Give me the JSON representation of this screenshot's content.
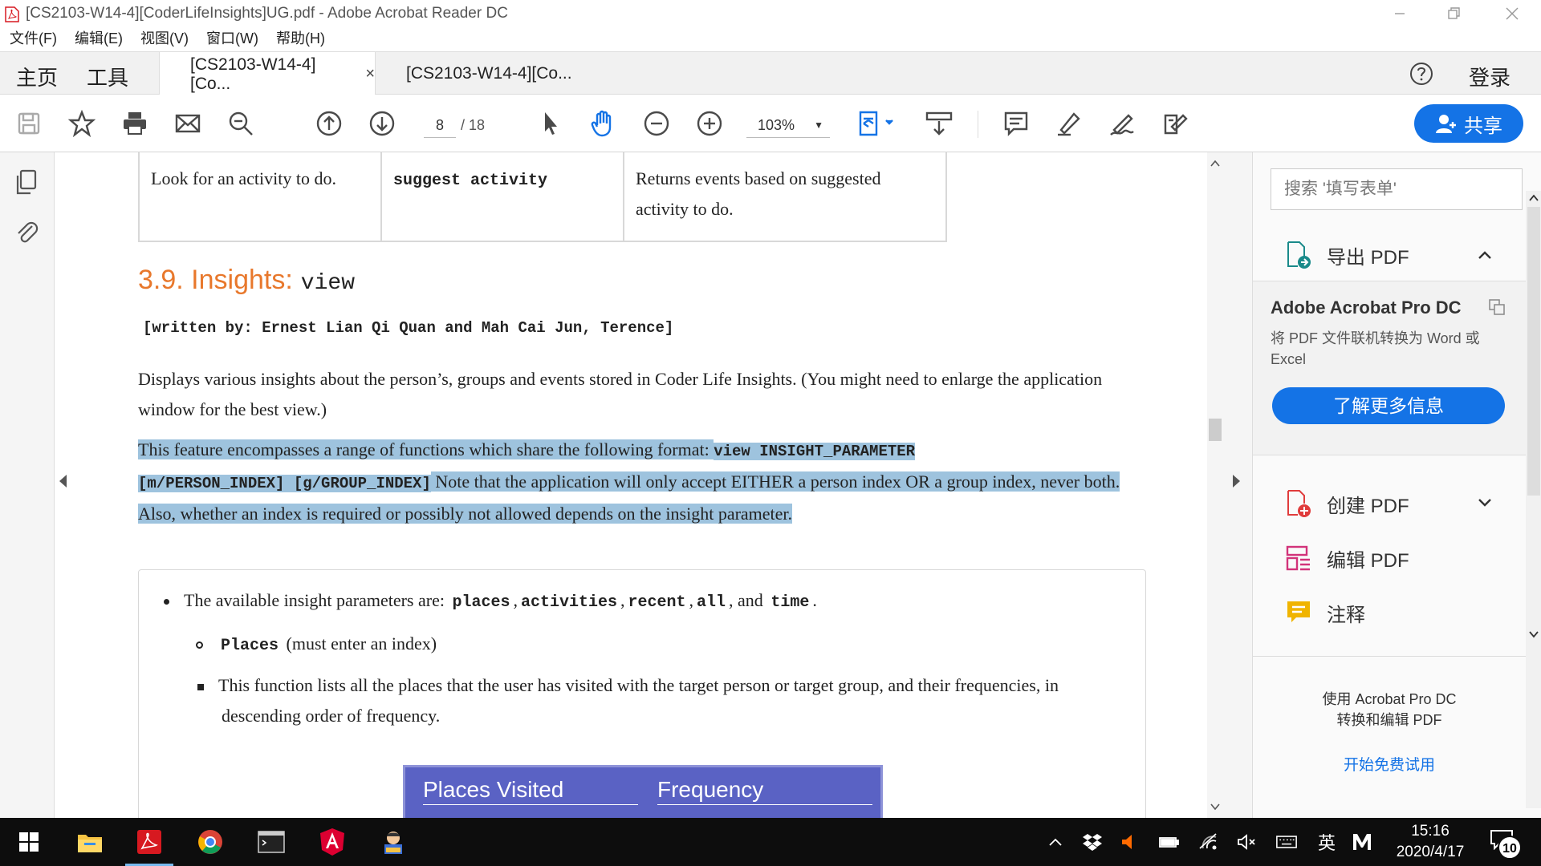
{
  "window": {
    "title": "[CS2103-W14-4][CoderLifeInsights]UG.pdf - Adobe Acrobat Reader DC"
  },
  "menu": [
    "文件(F)",
    "编辑(E)",
    "视图(V)",
    "窗口(W)",
    "帮助(H)"
  ],
  "tabs": {
    "home": "主页",
    "tools": "工具",
    "doc_tabs": [
      {
        "label": "[CS2103-W14-4][Co...",
        "active": true,
        "close": "×"
      },
      {
        "label": "[CS2103-W14-4][Co...",
        "active": false
      }
    ],
    "login": "登录"
  },
  "toolbar": {
    "page_current": "8",
    "page_total": "/ 18",
    "zoom": "103%",
    "share_label": "共享"
  },
  "document": {
    "table_row": {
      "col1": "Look for an activity to do.",
      "col2": "suggest activity",
      "col3": "Returns events based on suggested activity to do."
    },
    "heading": {
      "number_title": "3.9. Insights:",
      "code": "view"
    },
    "written_by": "[written by: Ernest Lian Qi Quan and Mah Cai Jun, Terence]",
    "para1": "Displays various insights about the person’s, groups and events stored in Coder Life Insights. (You might need to enlarge the application window for the best view.)",
    "para2_a": "This feature encompasses a range of functions which share the following format: ",
    "para2_code1": "view INSIGHT_PARAMETER",
    "para2_code2": "[m/PERSON_INDEX] [g/GROUP_INDEX]",
    "para2_b": " Note that the application will only accept EITHER a person index OR a group index, never both. Also, whether an index is required or possibly not allowed depends on the insight parameter.",
    "bullet1_prefix": "The available insight parameters are: ",
    "params": [
      "places",
      "activities",
      "recent",
      "all",
      "time"
    ],
    "and_text": "and",
    "sub_code": "Places",
    "sub_text": "(must enter an index)",
    "subsub_text": "This function lists all the places that the user has visited with the target person or target group, and their frequencies, in descending order of frequency.",
    "image_table": {
      "col1": "Places Visited",
      "col2": "Frequency"
    }
  },
  "right_panel": {
    "search_placeholder": "搜索 '填写表单'",
    "export": "导出 PDF",
    "pro_title": "Adobe Acrobat Pro DC",
    "pro_desc": "将 PDF 文件联机转换为 Word 或 Excel",
    "pro_button": "了解更多信息",
    "create": "创建 PDF",
    "edit": "编辑 PDF",
    "comment": "注释",
    "bottom_text_1": "使用 Acrobat Pro DC",
    "bottom_text_2": "转换和编辑 PDF",
    "bottom_link": "开始免费试用"
  },
  "taskbar": {
    "ime": "英",
    "time": "15:16",
    "date": "2020/4/17",
    "notifications": "10"
  },
  "colors": {
    "accent": "#1473e6",
    "heading": "#e8782c",
    "highlight": "#9ec3de"
  }
}
